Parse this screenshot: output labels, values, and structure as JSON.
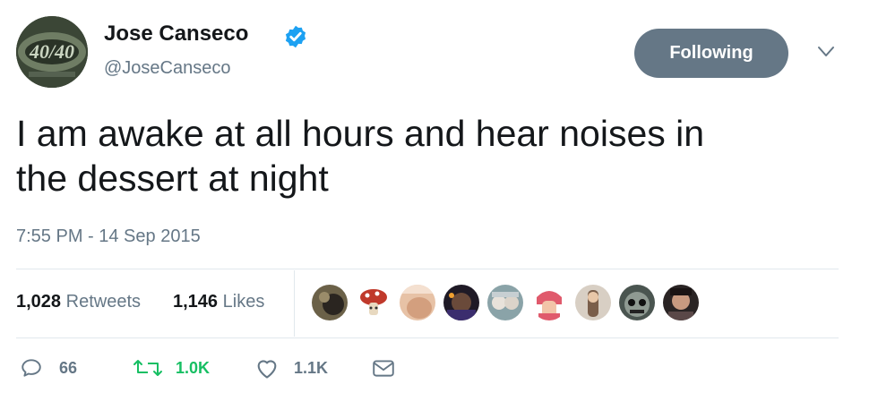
{
  "author": {
    "name": "Jose Canseco",
    "handle": "@JoseCanseco",
    "verified": true,
    "avatar_logo_text": "40/40"
  },
  "follow_button": {
    "label": "Following"
  },
  "tweet": {
    "text_line1": "I am awake at all hours and hear noises in",
    "text_line2": "the dessert at night",
    "timestamp": "7:55 PM - 14 Sep 2015"
  },
  "stats": {
    "retweets_count": "1,028",
    "retweets_label": "Retweets",
    "likes_count": "1,146",
    "likes_label": "Likes"
  },
  "actions": {
    "reply_count": "66",
    "retweet_count": "1.0K",
    "like_count": "1.1K"
  },
  "colors": {
    "secondary_text": "#657786",
    "retweet_green": "#17bf63",
    "verified_blue": "#1da1f2",
    "divider": "#e1e8ed"
  },
  "icons": [
    "verified-badge-icon",
    "chevron-down-icon",
    "reply-icon",
    "retweet-icon",
    "heart-icon",
    "message-icon"
  ]
}
